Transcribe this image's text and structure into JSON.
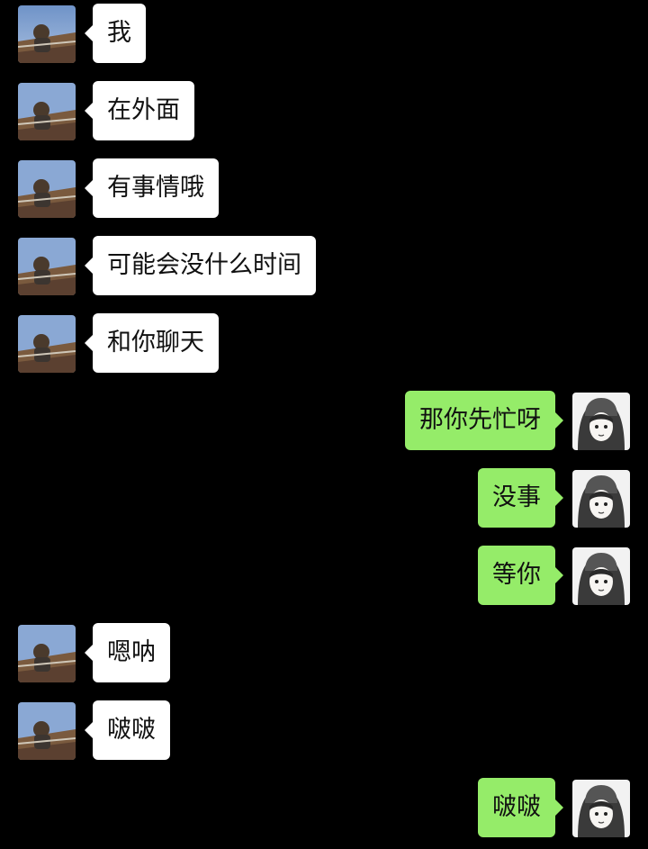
{
  "messages": [
    {
      "side": "left",
      "text": "我",
      "avatar": "contact-avatar"
    },
    {
      "side": "left",
      "text": "在外面",
      "avatar": "contact-avatar"
    },
    {
      "side": "left",
      "text": "有事情哦",
      "avatar": "contact-avatar"
    },
    {
      "side": "left",
      "text": "可能会没什么时间",
      "avatar": "contact-avatar"
    },
    {
      "side": "left",
      "text": "和你聊天",
      "avatar": "contact-avatar"
    },
    {
      "side": "right",
      "text": "那你先忙呀",
      "avatar": "self-avatar"
    },
    {
      "side": "right",
      "text": "没事",
      "avatar": "self-avatar"
    },
    {
      "side": "right",
      "text": "等你",
      "avatar": "self-avatar"
    },
    {
      "side": "left",
      "text": "嗯呐",
      "avatar": "contact-avatar"
    },
    {
      "side": "left",
      "text": "啵啵",
      "avatar": "contact-avatar"
    },
    {
      "side": "right",
      "text": "啵啵",
      "avatar": "self-avatar"
    }
  ],
  "colors": {
    "background": "#000000",
    "incoming_bubble": "#ffffff",
    "outgoing_bubble": "#95ec69",
    "text": "#111111"
  }
}
